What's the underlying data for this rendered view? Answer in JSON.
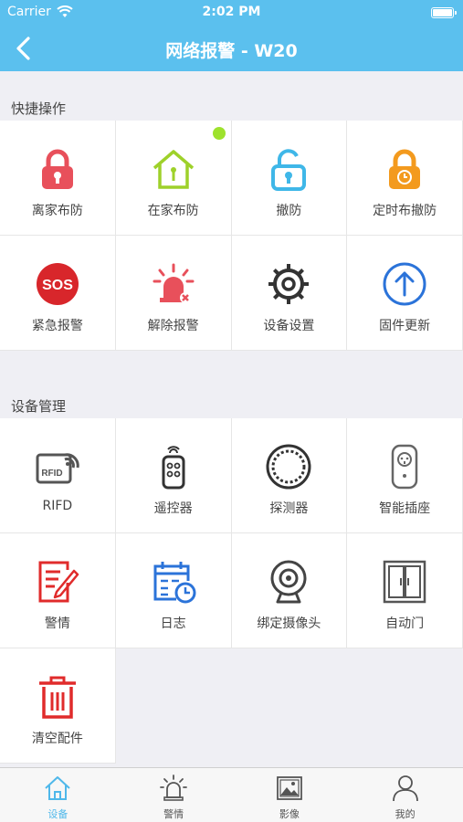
{
  "status_bar": {
    "carrier": "Carrier",
    "time": "2:02 PM"
  },
  "nav": {
    "title": "网络报警 - W20",
    "back_icon": "back-chevron-icon"
  },
  "quick_section": {
    "title": "快捷操作",
    "items": [
      {
        "label": "离家布防",
        "icon": "lock-closed-icon",
        "color": "#e8505b"
      },
      {
        "label": "在家布防",
        "icon": "home-arm-icon",
        "color": "#9ed12a"
      },
      {
        "label": "撤防",
        "icon": "lock-open-icon",
        "color": "#3fb7e8"
      },
      {
        "label": "定时布撤防",
        "icon": "timer-lock-icon",
        "color": "#f39a1e"
      },
      {
        "label": "紧急报警",
        "icon": "sos-icon",
        "color": "#d8262b"
      },
      {
        "label": "解除报警",
        "icon": "alarm-off-icon",
        "color": "#e8505b"
      },
      {
        "label": "设备设置",
        "icon": "gear-icon",
        "color": "#333333"
      },
      {
        "label": "固件更新",
        "icon": "upload-arrow-icon",
        "color": "#2b73d9"
      }
    ]
  },
  "device_section": {
    "title": "设备管理",
    "items": [
      {
        "label": "RIFD",
        "icon": "rfid-card-icon",
        "color": "#555555"
      },
      {
        "label": "遥控器",
        "icon": "remote-control-icon",
        "color": "#333333"
      },
      {
        "label": "探测器",
        "icon": "detector-icon",
        "color": "#333333"
      },
      {
        "label": "智能插座",
        "icon": "smart-plug-icon",
        "color": "#666666"
      },
      {
        "label": "警情",
        "icon": "alarm-log-icon",
        "color": "#e02b2b"
      },
      {
        "label": "日志",
        "icon": "calendar-log-icon",
        "color": "#2b73d9"
      },
      {
        "label": "绑定摄像头",
        "icon": "camera-icon",
        "color": "#444444"
      },
      {
        "label": "自动门",
        "icon": "door-icon",
        "color": "#555555"
      },
      {
        "label": "清空配件",
        "icon": "trash-icon",
        "color": "#e02b2b"
      }
    ]
  },
  "tabs": [
    {
      "label": "设备",
      "icon": "house-tab-icon",
      "active": true
    },
    {
      "label": "警情",
      "icon": "siren-tab-icon",
      "active": false
    },
    {
      "label": "影像",
      "icon": "image-tab-icon",
      "active": false
    },
    {
      "label": "我的",
      "icon": "person-tab-icon",
      "active": false
    }
  ],
  "colors": {
    "accent": "#5bc0ee",
    "tab_active": "#4fb8ea",
    "status_dot": "#9ee22d"
  }
}
